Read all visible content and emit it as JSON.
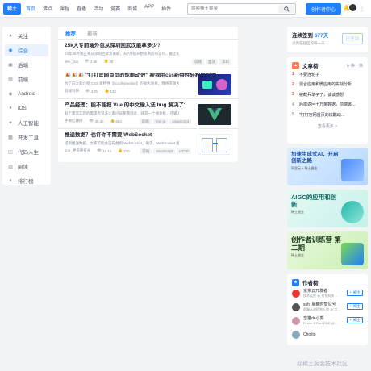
{
  "header": {
    "logo_text": "稀土",
    "nav": [
      "首页",
      "沸点",
      "课程",
      "直播",
      "活动",
      "竞赛",
      "商城",
      "APP",
      "插件"
    ],
    "search_placeholder": "探索稀土掘金",
    "creator_button": "创作者中心",
    "bell_icon": "bell-icon"
  },
  "sidebar": {
    "items": [
      {
        "icon": "★",
        "label": "关注"
      },
      {
        "icon": "◉",
        "label": "综合"
      },
      {
        "icon": "▣",
        "label": "后端"
      },
      {
        "icon": "▤",
        "label": "前端"
      },
      {
        "icon": "◆",
        "label": "Android"
      },
      {
        "icon": "●",
        "label": "iOS"
      },
      {
        "icon": "✦",
        "label": "人工智能"
      },
      {
        "icon": "▦",
        "label": "开发工具"
      },
      {
        "icon": "◫",
        "label": "代码人生"
      },
      {
        "icon": "▥",
        "label": "阅读"
      },
      {
        "icon": "▲",
        "label": "排行榜"
      }
    ],
    "active_index": 1
  },
  "feed": {
    "tabs": [
      "推荐",
      "最新"
    ],
    "active_tab": 0,
    "articles": [
      {
        "title": "25k大专前端外包从深圳回武汉能拿多少?",
        "abstract": "23年08月我正式从深圳回武汉离职，从7月初开始投简历的公司，截止8月底，2个月时间有…",
        "author": "dev_zuo",
        "views": "2.5k",
        "likes": "39",
        "tags": [
          "前端",
          "面试",
          "求职"
        ]
      },
      {
        "title": "🎉🎉🎉 \"钉钉官网首页的炫酷动效\" 被我用css新特性轻松破解啦~",
        "abstract": "为了向大家介绍 CSS 新特性【scroll-timeline】的强大效果，我将带领大家一起实现钉钉…",
        "author": "前端科研",
        "views": "4.7k",
        "likes": "133",
        "tags": [
          "前端",
          "CSS"
        ]
      },
      {
        "title": "产品经理：能不能把 Vue 的中文输入法 bug 解决了?",
        "abstract": "有个需求实现的需求有说法大家应该都遇到过，就是一个搜索框，还输入过程中要下拉提示…",
        "author": "手撕红薯树",
        "views": "30.3k",
        "likes": "554",
        "tags": [
          "前端",
          "Vue.js",
          "JavaScript"
        ]
      },
      {
        "title": "推送数据？也许你不需要 WebSocket",
        "abstract": "提到推送数据，大家可能会首先想到 WebSocket。确实，WebSocket 能双向通信，自然也…",
        "author": "zug_神说要有光",
        "views": "16.1k",
        "likes": "270",
        "tags": [
          "前端",
          "JavaScript",
          "HTTP"
        ]
      }
    ]
  },
  "checkin": {
    "title_prefix": "连续签到",
    "days": "677天",
    "subtitle": "点亮在社区的每一天",
    "button": "已签到"
  },
  "ranking": {
    "title": "文章榜",
    "switch": "换一换",
    "items": [
      "不要连轮子",
      "混合应用和微应用的实战分析",
      "被截兵单子了，谈谈感想",
      "后端返回十万条数据，前端该…",
      "\"钉钉官网首页的炫酷动…"
    ],
    "more": "查看更多 >"
  },
  "banners": [
    {
      "title": "加速生成式AI，开启创新之路",
      "sub": "阿里云 × 稀土掘金"
    },
    {
      "title": "AIGC的应用和创新",
      "sub": "稀土掘金"
    },
    {
      "title": "创作者训练营 第二期",
      "sub": "稀土掘金"
    }
  ],
  "authors": {
    "title": "作者榜",
    "follow": "+ 关注",
    "list": [
      {
        "name": "京东云开发者",
        "desc": "技术运营 @ 京东科技…"
      },
      {
        "name": "ssh_晨曦时梦见兮",
        "desc": "前端从进阶到入院 @ 字…"
      },
      {
        "name": "恋猫de小郭",
        "desc": "Flutter & Dart GDE @…"
      },
      {
        "name": "Cholito",
        "desc": ""
      }
    ]
  },
  "watermark": "@稀土掘金技术社区"
}
